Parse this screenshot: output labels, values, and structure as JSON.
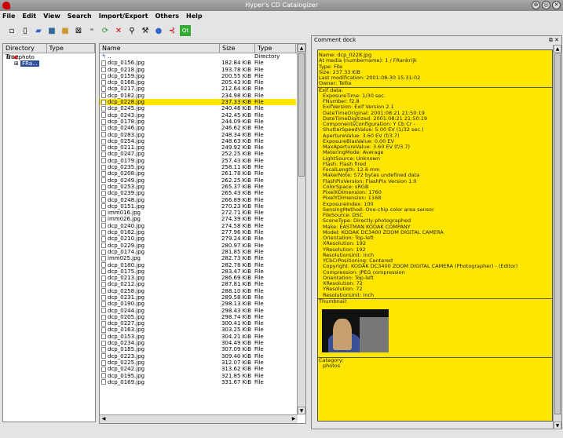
{
  "window": {
    "title": "Hyper's CD Catalogizer"
  },
  "menu": [
    "File",
    "Edit",
    "View",
    "Search",
    "Import/Export",
    "Others",
    "Help"
  ],
  "toolbar": [
    "new-icon",
    "open-icon",
    "folder-icon",
    "save-icon",
    "save-as-icon",
    "close-icon",
    "scan-icon",
    "refresh-icon",
    "delete-icon",
    "search-icon",
    "settings-icon",
    "help-icon",
    "ring-icon",
    "qt-icon"
  ],
  "dirtree": {
    "headers": [
      "Directory Tree",
      "Type"
    ],
    "root": "photo",
    "child": "FRa..."
  },
  "filelist": {
    "headers": [
      "Name",
      "Size",
      "Type"
    ],
    "rows": [
      {
        "name": "..",
        "size": "",
        "type": "Directory"
      },
      {
        "name": "dcp_0156.jpg",
        "size": "182.84 KiB",
        "type": "File"
      },
      {
        "name": "dcp_0218.jpg",
        "size": "193.78 KiB",
        "type": "File"
      },
      {
        "name": "dcp_0159.jpg",
        "size": "200.55 KiB",
        "type": "File"
      },
      {
        "name": "dcp_0168.jpg",
        "size": "205.43 KiB",
        "type": "File"
      },
      {
        "name": "dcp_0217.jpg",
        "size": "212.64 KiB",
        "type": "File"
      },
      {
        "name": "dcp_0182.jpg",
        "size": "234.98 KiB",
        "type": "File"
      },
      {
        "name": "dcp_0228.jpg",
        "size": "237.33 KiB",
        "type": "File",
        "sel": true
      },
      {
        "name": "dcp_0245.jpg",
        "size": "240.46 KiB",
        "type": "File"
      },
      {
        "name": "dcp_0243.jpg",
        "size": "242.45 KiB",
        "type": "File"
      },
      {
        "name": "dcp_0178.jpg",
        "size": "244.09 KiB",
        "type": "File"
      },
      {
        "name": "dcp_0246.jpg",
        "size": "246.62 KiB",
        "type": "File"
      },
      {
        "name": "dcp_0283.jpg",
        "size": "248.34 KiB",
        "type": "File"
      },
      {
        "name": "dcp_0254.jpg",
        "size": "248.63 KiB",
        "type": "File"
      },
      {
        "name": "dcp_0211.jpg",
        "size": "249.92 KiB",
        "type": "File"
      },
      {
        "name": "dcp_0247.jpg",
        "size": "252.25 KiB",
        "type": "File"
      },
      {
        "name": "dcp_0179.jpg",
        "size": "257.43 KiB",
        "type": "File"
      },
      {
        "name": "dcp_0235.jpg",
        "size": "258.11 KiB",
        "type": "File"
      },
      {
        "name": "dcp_0208.jpg",
        "size": "261.78 KiB",
        "type": "File"
      },
      {
        "name": "dcp_0249.jpg",
        "size": "262.25 KiB",
        "type": "File"
      },
      {
        "name": "dcp_0253.jpg",
        "size": "265.37 KiB",
        "type": "File"
      },
      {
        "name": "dcp_0239.jpg",
        "size": "265.43 KiB",
        "type": "File"
      },
      {
        "name": "dcp_0248.jpg",
        "size": "266.89 KiB",
        "type": "File"
      },
      {
        "name": "dcp_0151.jpg",
        "size": "270.23 KiB",
        "type": "File"
      },
      {
        "name": "imm016.jpg",
        "size": "272.71 KiB",
        "type": "File"
      },
      {
        "name": "imm026.jpg",
        "size": "274.39 KiB",
        "type": "File"
      },
      {
        "name": "dcp_0240.jpg",
        "size": "274.58 KiB",
        "type": "File"
      },
      {
        "name": "dcp_0162.jpg",
        "size": "277.96 KiB",
        "type": "File"
      },
      {
        "name": "dcp_0210.jpg",
        "size": "279.24 KiB",
        "type": "File"
      },
      {
        "name": "dcp_0229.jpg",
        "size": "280.97 KiB",
        "type": "File"
      },
      {
        "name": "dcp_0174.jpg",
        "size": "281.85 KiB",
        "type": "File"
      },
      {
        "name": "imm025.jpg",
        "size": "282.73 KiB",
        "type": "File"
      },
      {
        "name": "dcp_0180.jpg",
        "size": "282.78 KiB",
        "type": "File"
      },
      {
        "name": "dcp_0175.jpg",
        "size": "283.47 KiB",
        "type": "File"
      },
      {
        "name": "dcp_0213.jpg",
        "size": "286.69 KiB",
        "type": "File"
      },
      {
        "name": "dcp_0212.jpg",
        "size": "287.81 KiB",
        "type": "File"
      },
      {
        "name": "dcp_0258.jpg",
        "size": "288.10 KiB",
        "type": "File"
      },
      {
        "name": "dcp_0231.jpg",
        "size": "289.58 KiB",
        "type": "File"
      },
      {
        "name": "dcp_0190.jpg",
        "size": "298.13 KiB",
        "type": "File"
      },
      {
        "name": "dcp_0244.jpg",
        "size": "298.43 KiB",
        "type": "File"
      },
      {
        "name": "dcp_0205.jpg",
        "size": "298.74 KiB",
        "type": "File"
      },
      {
        "name": "dcp_0227.jpg",
        "size": "300.41 KiB",
        "type": "File"
      },
      {
        "name": "dcp_0163.jpg",
        "size": "303.25 KiB",
        "type": "File"
      },
      {
        "name": "dcp_0153.jpg",
        "size": "304.21 KiB",
        "type": "File"
      },
      {
        "name": "dcp_0234.jpg",
        "size": "304.49 KiB",
        "type": "File"
      },
      {
        "name": "dcp_0185.jpg",
        "size": "307.09 KiB",
        "type": "File"
      },
      {
        "name": "dcp_0223.jpg",
        "size": "309.40 KiB",
        "type": "File"
      },
      {
        "name": "dcp_0225.jpg",
        "size": "312.07 KiB",
        "type": "File"
      },
      {
        "name": "dcp_0242.jpg",
        "size": "313.62 KiB",
        "type": "File"
      },
      {
        "name": "dcp_0195.jpg",
        "size": "321.85 KiB",
        "type": "File"
      },
      {
        "name": "dcp_0169.jpg",
        "size": "331.67 KiB",
        "type": "File"
      }
    ]
  },
  "dock": {
    "title": "Comment dock",
    "lines": [
      {
        "t": "Name: dcp_0228.jpg"
      },
      {
        "t": "At media (numbername):     1 / FRankrijk"
      },
      {
        "t": "Type: File"
      },
      {
        "t": "Size: 237.33 KiB"
      },
      {
        "t": "Last modification: 2001-08-30 15:31:02"
      },
      {
        "t": "Owner: Tellie"
      },
      {
        "t": "Exif data:",
        "b": true
      },
      {
        "t": "ExposureTime: 1/30 sec.",
        "i": true
      },
      {
        "t": "FNumber: f2.8",
        "i": true
      },
      {
        "t": "ExifVersion: Exif Version 2.1",
        "i": true
      },
      {
        "t": "DateTimeOriginal: 2001:08:21 21:50:19",
        "i": true
      },
      {
        "t": "DateTimeDigitized: 2001:08:21 21:50:19",
        "i": true
      },
      {
        "t": "ComponentsConfiguration: Y Cb Cr -",
        "i": true
      },
      {
        "t": "ShutterSpeedValue: 5.00 EV (1/32 sec.)",
        "i": true
      },
      {
        "t": "ApertureValue: 3.60 EV (f/3.7)",
        "i": true
      },
      {
        "t": "ExposureBiasValue: 0.00 EV",
        "i": true
      },
      {
        "t": "MaxApertureValue: 3.60 EV (f/3.7)",
        "i": true
      },
      {
        "t": "MeteringMode: Average",
        "i": true
      },
      {
        "t": "LightSource: Unknown",
        "i": true
      },
      {
        "t": "Flash: Flash fired",
        "i": true
      },
      {
        "t": "FocalLength: 12.6 mm",
        "i": true
      },
      {
        "t": "MakerNote: 572 bytes undefined data",
        "i": true
      },
      {
        "t": "FlashPixVersion: FlashPix Version 1.0",
        "i": true
      },
      {
        "t": "ColorSpace: sRGB",
        "i": true
      },
      {
        "t": "PixelXDimension: 1760",
        "i": true
      },
      {
        "t": "PixelYDimension: 1168",
        "i": true
      },
      {
        "t": "ExposureIndex: 100",
        "i": true
      },
      {
        "t": "SensingMethod: One-chip color area sensor",
        "i": true
      },
      {
        "t": "FileSource: DSC",
        "i": true
      },
      {
        "t": "SceneType: Directly photographed",
        "i": true
      },
      {
        "t": "Make: EASTMAN KODAK COMPANY",
        "i": true
      },
      {
        "t": "Model: KODAK DC3400 ZOOM DIGITAL CAMERA",
        "i": true
      },
      {
        "t": "Orientation: Top-left",
        "i": true
      },
      {
        "t": "XResolution: 192",
        "i": true
      },
      {
        "t": "YResolution: 192",
        "i": true
      },
      {
        "t": "ResolutionUnit: Inch",
        "i": true
      },
      {
        "t": "YCbCrPositioning: Centered",
        "i": true
      },
      {
        "t": "Copyright: KODAK DC3400 ZOOM DIGITAL CAMERA (Photographer) -  (Editor)",
        "i": true
      },
      {
        "t": "Compression: JPEG compression",
        "i": true
      },
      {
        "t": "Orientation: Top-left",
        "i": true
      },
      {
        "t": "XResolution: 72",
        "i": true
      },
      {
        "t": "YResolution: 72",
        "i": true
      },
      {
        "t": "ResolutionUnit: Inch",
        "i": true
      },
      {
        "t": "Thumbnail:",
        "b": true
      }
    ],
    "category_label": "Category:",
    "category_value": "photos"
  },
  "colors": {
    "highlight": "#ffe600"
  }
}
